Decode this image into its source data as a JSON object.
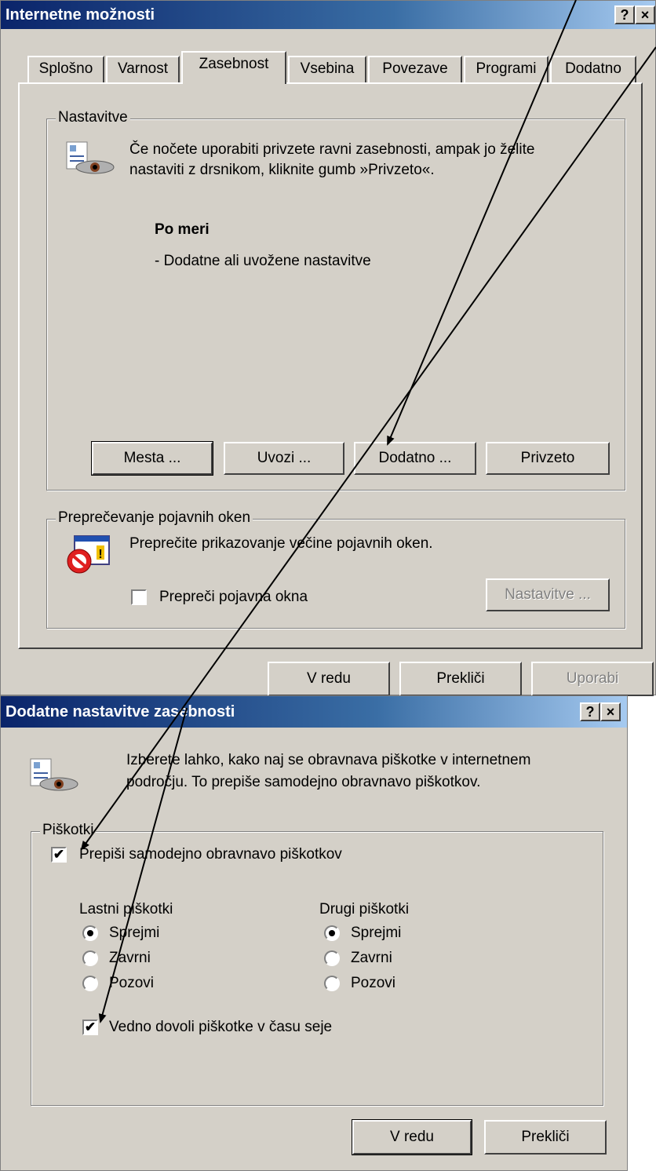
{
  "window1": {
    "title": "Internetne možnosti",
    "help_btn": "?",
    "close_btn": "×",
    "tabs": [
      "Splošno",
      "Varnost",
      "Zasebnost",
      "Vsebina",
      "Povezave",
      "Programi",
      "Dodatno"
    ],
    "settings_group": {
      "label": "Nastavitve",
      "desc_line1": "Če nočete uporabiti privzete ravni zasebnosti, ampak jo želite",
      "desc_line2": "nastaviti z drsnikom, kliknite gumb »Privzeto«.",
      "level_title": "Po meri",
      "level_desc": "- Dodatne ali uvožene nastavitve",
      "buttons": [
        "Mesta ...",
        "Uvozi ...",
        "Dodatno ...",
        "Privzeto"
      ]
    },
    "popup_group": {
      "label": "Preprečevanje pojavnih oken",
      "desc": "Preprečite prikazovanje večine pojavnih oken.",
      "checkbox_label": "Prepreči pojavna okna",
      "settings_btn": "Nastavitve ..."
    },
    "footer": {
      "ok": "V redu",
      "cancel": "Prekliči",
      "apply": "Uporabi"
    }
  },
  "window2": {
    "title": "Dodatne nastavitve zasebnosti",
    "help_btn": "?",
    "close_btn": "×",
    "desc_line1": "Izberete lahko, kako naj se obravnava piškotke v internetnem",
    "desc_line2": "področju. To prepiše samodejno obravnavo piškotkov.",
    "cookies_group": {
      "label": "Piškotki",
      "override_label": "Prepiši samodejno obravnavo piškotkov",
      "override_checked": true,
      "first_party": {
        "label": "Lastni piškotki",
        "options": [
          "Sprejmi",
          "Zavrni",
          "Pozovi"
        ],
        "selected": "Sprejmi"
      },
      "third_party": {
        "label": "Drugi piškotki",
        "options": [
          "Sprejmi",
          "Zavrni",
          "Pozovi"
        ],
        "selected": "Sprejmi"
      },
      "session_label": "Vedno dovoli piškotke v času seje",
      "session_checked": true
    },
    "footer": {
      "ok": "V redu",
      "cancel": "Prekliči"
    }
  },
  "check_mark": "✔"
}
